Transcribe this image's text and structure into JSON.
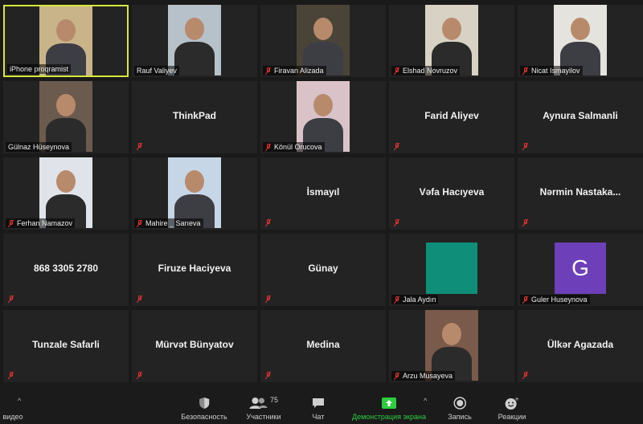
{
  "participants": [
    {
      "name": "iPhone proqramist",
      "video": true,
      "muted": false,
      "active": true
    },
    {
      "name": "Rauf Valiyev",
      "video": true,
      "muted": false
    },
    {
      "name": "Firavan Alizada",
      "video": true,
      "muted": true
    },
    {
      "name": "Elshad Novruzov",
      "video": true,
      "muted": true
    },
    {
      "name": "Nicat Ismayilov",
      "video": true,
      "muted": true
    },
    {
      "name": "Gülnaz Hüseynova",
      "video": true,
      "muted": false
    },
    {
      "name": "ThinkPad",
      "video": false,
      "muted": true
    },
    {
      "name": "Könül Orucova",
      "video": true,
      "muted": true
    },
    {
      "name": "Farid Aliyev",
      "video": false,
      "muted": true
    },
    {
      "name": "Aynura Salmanli",
      "video": false,
      "muted": true
    },
    {
      "name": "Ferhan Namazov",
      "video": true,
      "muted": true
    },
    {
      "name": "Mahire _ Sarıeva",
      "video": true,
      "muted": true
    },
    {
      "name": "İsmayıl",
      "video": false,
      "muted": true
    },
    {
      "name": "Vəfa Hacıyeva",
      "video": false,
      "muted": true
    },
    {
      "name": "Nərmin  Nastaka...",
      "video": false,
      "muted": true
    },
    {
      "name": "868 3305 2780",
      "video": false,
      "muted": true
    },
    {
      "name": "Firuze Haciyeva",
      "video": false,
      "muted": true
    },
    {
      "name": "Günay",
      "video": false,
      "muted": true
    },
    {
      "name": "Jala Aydın",
      "video": true,
      "muted": true,
      "swatch": "#0f8f7a"
    },
    {
      "name": "Guler Huseynova",
      "video": true,
      "muted": true,
      "swatch": "#6d3fb8",
      "letter": "G"
    },
    {
      "name": "Tunzale Safarli",
      "video": false,
      "muted": true
    },
    {
      "name": "Mürvət Bünyatov",
      "video": false,
      "muted": true
    },
    {
      "name": "Medina",
      "video": false,
      "muted": true
    },
    {
      "name": "Arzu Musayeva",
      "video": true,
      "muted": true
    },
    {
      "name": "Ülkər Agazada",
      "video": false,
      "muted": true
    }
  ],
  "toolbar": {
    "video_label": "видео",
    "security_label": "Безопасность",
    "participants_label": "Участники",
    "participants_count": "75",
    "chat_label": "Чат",
    "share_label": "Демонстрация экрана",
    "record_label": "Запись",
    "reactions_label": "Реакции",
    "caret": "^",
    "share_color": "#2ecc40"
  }
}
